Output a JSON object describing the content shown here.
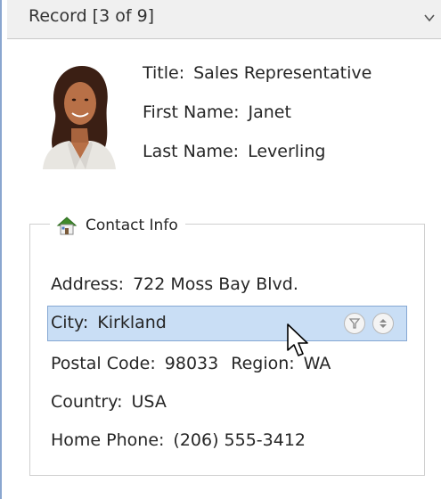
{
  "header": {
    "title": "Record [3 of 9]",
    "collapse_icon": "chevron-down-icon"
  },
  "employee": {
    "photo_icon": "employee-photo",
    "title_label": "Title:",
    "title_value": "Sales Representative",
    "first_name_label": "First Name:",
    "first_name_value": "Janet",
    "last_name_label": "Last Name:",
    "last_name_value": "Leverling"
  },
  "contact": {
    "group_title": "Contact Info",
    "group_icon": "house-icon",
    "address_label": "Address:",
    "address_value": "722 Moss Bay Blvd.",
    "city_label": "City:",
    "city_value": "Kirkland",
    "filter_icon": "filter-icon",
    "sort_icon": "sort-icon",
    "postal_code_label": "Postal Code:",
    "postal_code_value": "98033",
    "region_label": "Region:",
    "region_value": "WA",
    "country_label": "Country:",
    "country_value": "USA",
    "home_phone_label": "Home Phone:",
    "home_phone_value": "(206) 555-3412"
  },
  "colors": {
    "selection_fill": "#c9def5",
    "selection_border": "#86a8d3",
    "header_bg": "#f0f0f0"
  }
}
